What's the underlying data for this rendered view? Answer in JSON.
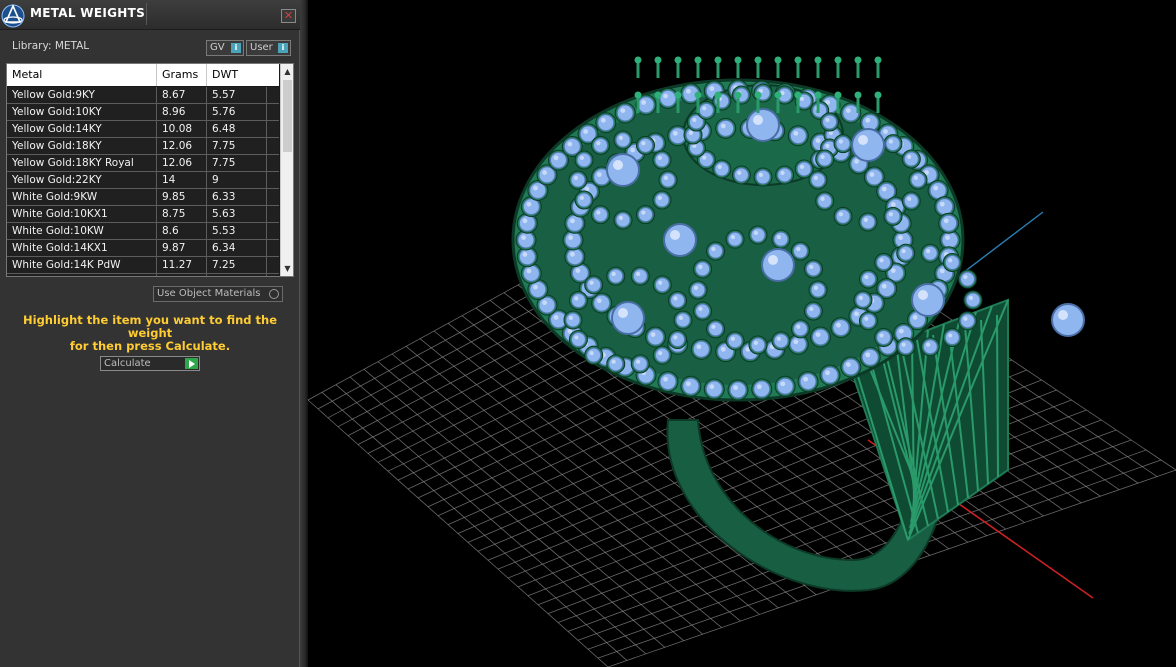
{
  "panel": {
    "title": "METAL WEIGHTS",
    "close_symbol": "✕",
    "library_label": "Library: METAL",
    "gv_label": "GV",
    "user_label": "User",
    "info_symbol": "i"
  },
  "table": {
    "columns": [
      "Metal",
      "Grams",
      "DWT"
    ],
    "rows": [
      {
        "metal": "Yellow Gold:9KY",
        "grams": "8.67",
        "dwt": "5.57"
      },
      {
        "metal": "Yellow Gold:10KY",
        "grams": "8.96",
        "dwt": "5.76"
      },
      {
        "metal": "Yellow Gold:14KY",
        "grams": "10.08",
        "dwt": "6.48"
      },
      {
        "metal": "Yellow Gold:18KY",
        "grams": "12.06",
        "dwt": "7.75"
      },
      {
        "metal": "Yellow Gold:18KY Royal",
        "grams": "12.06",
        "dwt": "7.75"
      },
      {
        "metal": "Yellow Gold:22KY",
        "grams": "14",
        "dwt": "9"
      },
      {
        "metal": "White Gold:9KW",
        "grams": "9.85",
        "dwt": "6.33"
      },
      {
        "metal": "White Gold:10KX1",
        "grams": "8.75",
        "dwt": "5.63"
      },
      {
        "metal": "White Gold:10KW",
        "grams": "8.6",
        "dwt": "5.53"
      },
      {
        "metal": "White Gold:14KX1",
        "grams": "9.87",
        "dwt": "6.34"
      },
      {
        "metal": "White Gold:14K PdW",
        "grams": "11.27",
        "dwt": "7.25"
      }
    ]
  },
  "controls": {
    "use_object_materials": "Use Object Materials",
    "instructions_line1": "Highlight the item you want to find the weight",
    "instructions_line2": "for then press Calculate.",
    "calculate_label": "Calculate"
  },
  "colors": {
    "instructions": "#ffcc33",
    "ring_metal": "#1f7a55",
    "gem": "#8fb6ee",
    "grid": "#8a8a8a",
    "axis_x": "#cc2222",
    "axis_y": "#2b7fb5"
  }
}
